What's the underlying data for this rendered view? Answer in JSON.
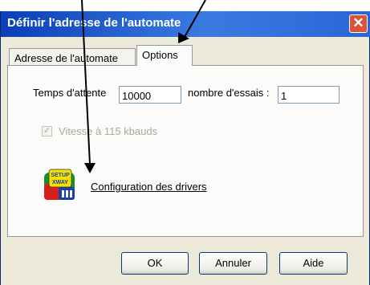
{
  "window": {
    "title": "Définir l'adresse de l'automate",
    "close_glyph": "✕"
  },
  "tabs": [
    {
      "label": "Adresse de l'automate"
    },
    {
      "label": "Options"
    }
  ],
  "options": {
    "wait_label": "Temps d'attente",
    "wait_value": "10000",
    "tries_label": "nombre d'essais :",
    "tries_value": "1",
    "speed_label": "Vitesse à 115 kbauds",
    "speed_checked": true,
    "speed_disabled": true,
    "config_label": "Configuration des drivers",
    "config_icon": "setup-xway-icon",
    "icon_text": {
      "line1": "SETUP",
      "line2": "XWAY"
    }
  },
  "buttons": {
    "ok": "OK",
    "cancel": "Annuler",
    "help": "Aide"
  },
  "annotations": {
    "arrow_color": "#000000",
    "count": 2
  }
}
